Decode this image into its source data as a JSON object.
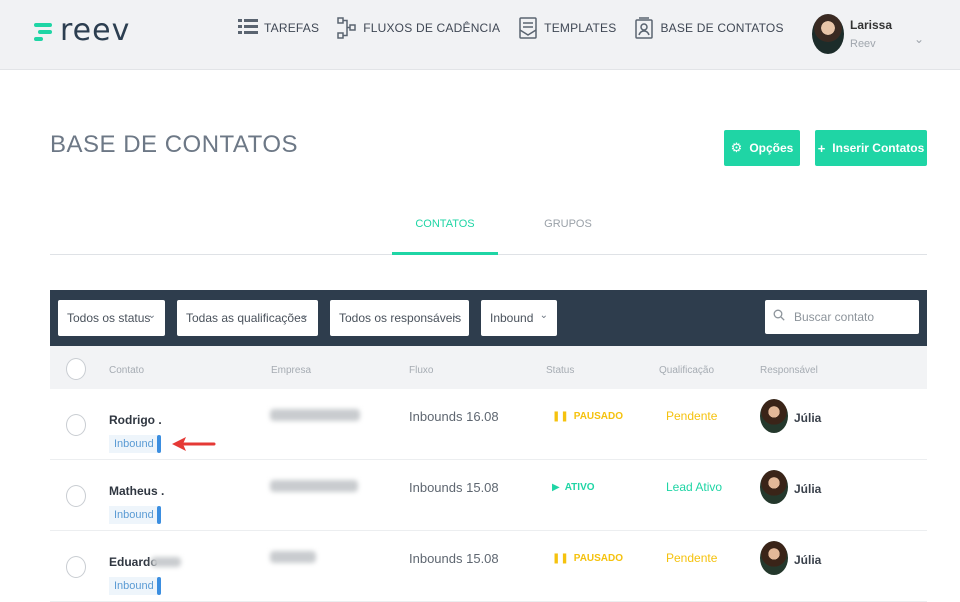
{
  "app": {
    "logo_text": "reev",
    "brand_color": "#1fd5a5"
  },
  "nav": {
    "items": [
      {
        "label": "TAREFAS",
        "icon": "list-icon"
      },
      {
        "label": "FLUXOS DE CADÊNCIA",
        "icon": "flow-icon"
      },
      {
        "label": "TEMPLATES",
        "icon": "template-icon"
      },
      {
        "label": "BASE DE CONTATOS",
        "icon": "contacts-icon"
      }
    ]
  },
  "user": {
    "name": "Larissa",
    "org": "Reev"
  },
  "page": {
    "title": "BASE DE CONTATOS"
  },
  "actions": {
    "options_label": "Opções",
    "insert_label": "Inserir Contatos"
  },
  "tabs": [
    {
      "label": "CONTATOS",
      "active": true
    },
    {
      "label": "GRUPOS",
      "active": false
    }
  ],
  "filters": {
    "status": "Todos os status",
    "qualification": "Todas as qualificações",
    "owner": "Todos os responsáveis",
    "source": "Inbound",
    "search_placeholder": "Buscar contato"
  },
  "table": {
    "columns": [
      "Contato",
      "Empresa",
      "Fluxo",
      "Status",
      "Qualificação",
      "Responsável"
    ],
    "rows": [
      {
        "name": "Rodrigo .",
        "tag": "Inbound",
        "flow": "Inbounds 16.08",
        "status": "PAUSADO",
        "status_kind": "paused",
        "qualification": "Pendente",
        "qual_kind": "pending",
        "owner": "Júlia"
      },
      {
        "name": "Matheus .",
        "tag": "Inbound",
        "flow": "Inbounds 15.08",
        "status": "ATIVO",
        "status_kind": "active",
        "qualification": "Lead Ativo",
        "qual_kind": "active",
        "owner": "Júlia"
      },
      {
        "name": "Eduardo",
        "tag": "Inbound",
        "flow": "Inbounds 15.08",
        "status": "PAUSADO",
        "status_kind": "paused",
        "qualification": "Pendente",
        "qual_kind": "pending",
        "owner": "Júlia"
      }
    ]
  }
}
